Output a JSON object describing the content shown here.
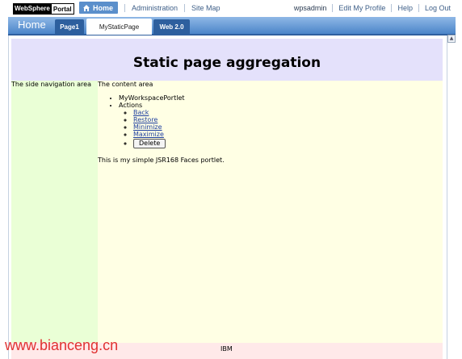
{
  "brand": {
    "logo_left": "WebSphere",
    "logo_right": "Portal"
  },
  "top_nav": {
    "home": "Home",
    "administration": "Administration",
    "site_map": "Site Map"
  },
  "user_bar": {
    "username": "wpsadmin",
    "edit_profile": "Edit My Profile",
    "help": "Help",
    "logout": "Log Out"
  },
  "banner": {
    "site_title": "Home",
    "tabs": [
      {
        "label": "Page1",
        "active": false
      },
      {
        "label": "MyStaticPage",
        "active": true
      },
      {
        "label": "Web 2.0",
        "active": false
      }
    ]
  },
  "page": {
    "header_title": "Static page aggregation",
    "side_label": "The side navigation area",
    "content_label": "The content area",
    "portlet_name": "MyWorkspacePortlet",
    "actions_label": "Actions",
    "actions": [
      "Back",
      "Restore",
      "Minimize",
      "Maximize"
    ],
    "delete_button": "Delete",
    "portlet_text": "This is my simple JSR168 Faces portlet.",
    "footer": "IBM"
  },
  "watermark": "www.bianceng.cn",
  "colors": {
    "home_button": "#5b8fcb",
    "banner_blue": "#4b85c9",
    "tab_dark": "#2d5f9e",
    "header_bg": "#e4e1fb",
    "side_bg": "#eaffd6",
    "content_bg": "#ffffe4",
    "footer_bg": "#ffe9e9",
    "link": "#1f3fa0",
    "watermark": "#e03131"
  },
  "icons": {
    "home": "house-icon",
    "scroll_up": "scroll-up-arrow-icon"
  }
}
